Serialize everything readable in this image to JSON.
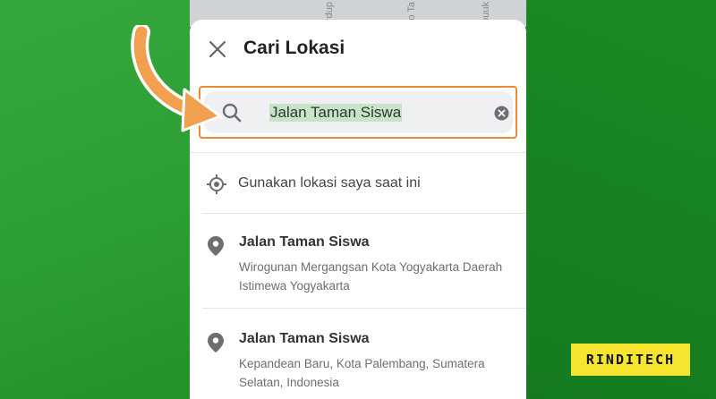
{
  "map_labels": [
    "rdup",
    "o Ta",
    "ouuk"
  ],
  "header": {
    "title": "Cari Lokasi"
  },
  "search": {
    "value": "Jalan Taman Siswa"
  },
  "current_location": {
    "label": "Gunakan lokasi saya saat ini"
  },
  "results": [
    {
      "title": "Jalan Taman Siswa",
      "address": "Wirogunan Mergangsan Kota Yogyakarta Daerah Istimewa Yogyakarta"
    },
    {
      "title": "Jalan Taman Siswa",
      "address": "Kepandean Baru, Kota Palembang, Sumatera Selatan, Indonesia"
    }
  ],
  "watermark": {
    "text": "RINDITECH"
  },
  "colors": {
    "highlight_border": "#ef8a34",
    "background_green": "#259230",
    "watermark_yellow": "#f5e52e"
  }
}
